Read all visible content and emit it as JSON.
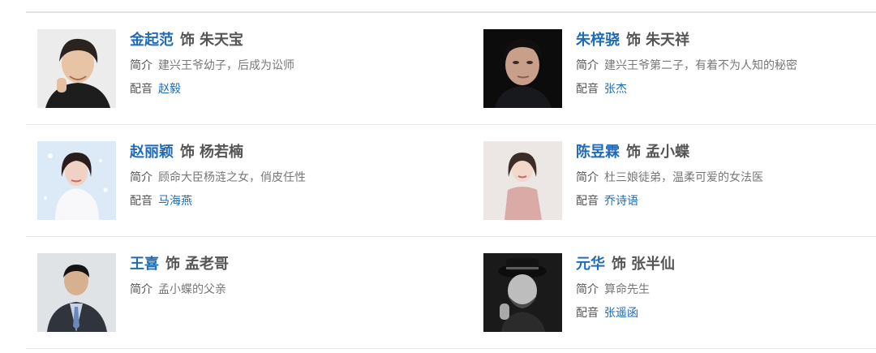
{
  "cast": [
    {
      "left": {
        "actor": "金起范",
        "as": "饰",
        "role": "朱天宝",
        "intro_label": "简介",
        "intro": "建兴王爷幼子，后成为讼师",
        "voice_label": "配音",
        "voice": "赵毅",
        "photo": "man-photo"
      },
      "right": {
        "actor": "朱梓骁",
        "as": "饰",
        "role": "朱天祥",
        "intro_label": "简介",
        "intro": "建兴王爷第二子，有着不为人知的秘密",
        "voice_label": "配音",
        "voice": "张杰",
        "photo": "man-photo"
      }
    },
    {
      "left": {
        "actor": "赵丽颖",
        "as": "饰",
        "role": "杨若楠",
        "intro_label": "简介",
        "intro": "顾命大臣杨涟之女，俏皮任性",
        "voice_label": "配音",
        "voice": "马海燕",
        "photo": "woman-photo"
      },
      "right": {
        "actor": "陈昱霖",
        "as": "饰",
        "role": "孟小蝶",
        "intro_label": "简介",
        "intro": "杜三娘徒弟，温柔可爱的女法医",
        "voice_label": "配音",
        "voice": "乔诗语",
        "photo": "woman-photo"
      }
    },
    {
      "left": {
        "actor": "王喜",
        "as": "饰",
        "role": "孟老哥",
        "intro_label": "简介",
        "intro": "孟小蝶的父亲",
        "photo": "man-photo"
      },
      "right": {
        "actor": "元华",
        "as": "饰",
        "role": "张半仙",
        "intro_label": "简介",
        "intro": "算命先生",
        "voice_label": "配音",
        "voice": "张遥函",
        "photo": "man-photo"
      }
    }
  ]
}
